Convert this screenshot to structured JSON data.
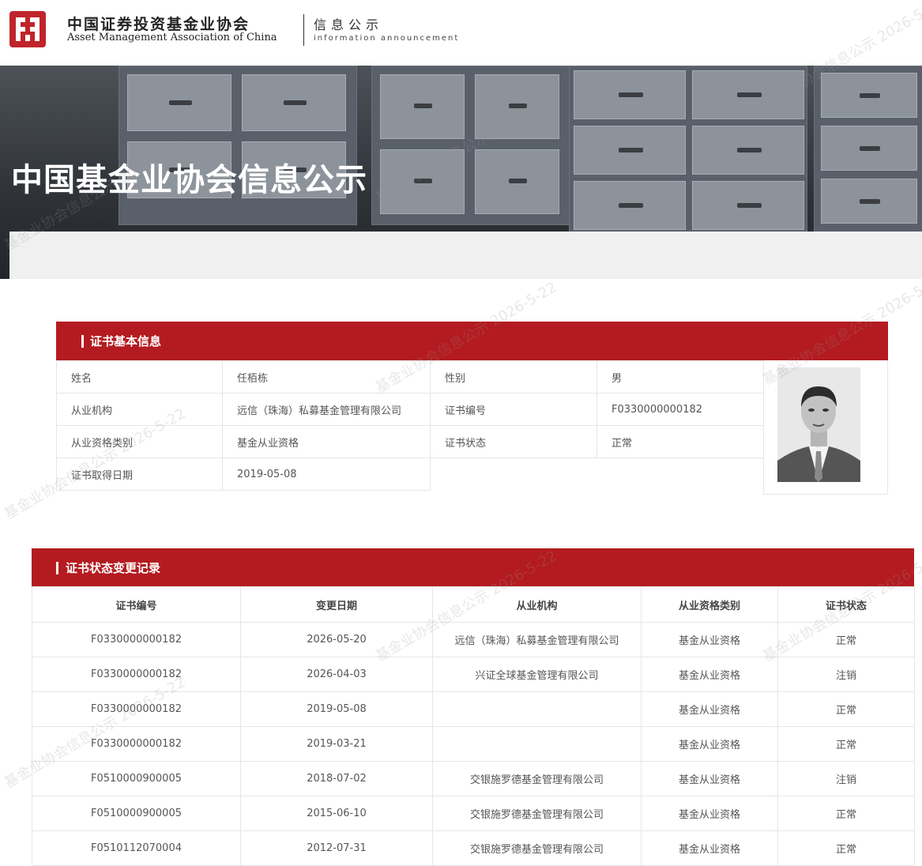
{
  "header": {
    "org_name_cn": "中国证券投资基金业协会",
    "org_name_en": "Asset Management Association of China",
    "section_cn": "信息公示",
    "section_en": "information announcement"
  },
  "banner": {
    "title": "中国基金业协会信息公示"
  },
  "basic_info": {
    "section_title": "证书基本信息",
    "name_label": "姓名",
    "name_value": "任栢栋",
    "gender_label": "性别",
    "gender_value": "男",
    "employer_label": "从业机构",
    "employer_value": "远信（珠海）私募基金管理有限公司",
    "cert_no_label": "证书编号",
    "cert_no_value": "F0330000000182",
    "qual_type_label": "从业资格类别",
    "qual_type_value": "基金从业资格",
    "cert_status_label": "证书状态",
    "cert_status_value": "正常",
    "cert_date_label": "证书取得日期",
    "cert_date_value": "2019-05-08"
  },
  "history": {
    "section_title": "证书状态变更记录",
    "columns": [
      "证书编号",
      "变更日期",
      "从业机构",
      "从业资格类别",
      "证书状态"
    ],
    "rows": [
      [
        "F0330000000182",
        "2026-05-20",
        "远信（珠海）私募基金管理有限公司",
        "基金从业资格",
        "正常"
      ],
      [
        "F0330000000182",
        "2026-04-03",
        "兴证全球基金管理有限公司",
        "基金从业资格",
        "注销"
      ],
      [
        "F0330000000182",
        "2019-05-08",
        "",
        "基金从业资格",
        "正常"
      ],
      [
        "F0330000000182",
        "2019-03-21",
        "",
        "基金从业资格",
        "正常"
      ],
      [
        "F0510000900005",
        "2018-07-02",
        "交银施罗德基金管理有限公司",
        "基金从业资格",
        "注销"
      ],
      [
        "F0510000900005",
        "2015-06-10",
        "交银施罗德基金管理有限公司",
        "基金从业资格",
        "正常"
      ],
      [
        "F0510112070004",
        "2012-07-31",
        "交银施罗德基金管理有限公司",
        "基金从业资格",
        "正常"
      ]
    ]
  },
  "watermark": {
    "text": "基金业协会信息公示 2026-5-22"
  },
  "colors": {
    "brand_red": "#b31b20",
    "border": "#e6e6e6"
  }
}
